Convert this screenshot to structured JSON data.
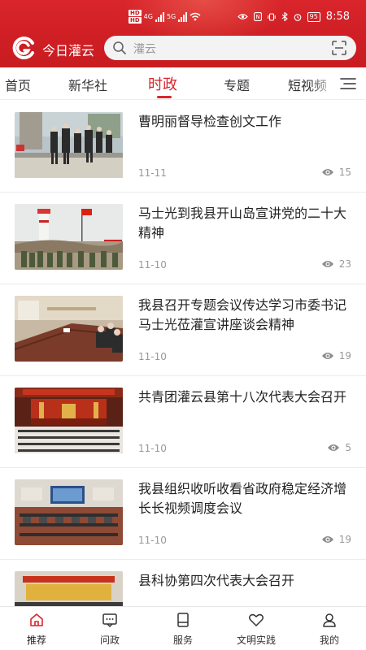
{
  "status_bar": {
    "sim1": "HD",
    "sim2": "HD",
    "network": "4G",
    "network2": "5G",
    "battery": "95",
    "time": "8:58"
  },
  "header": {
    "app_name": "今日灌云",
    "search_placeholder": "灌云"
  },
  "tabs": [
    {
      "label": "首页"
    },
    {
      "label": "新华社"
    },
    {
      "label": "时政"
    },
    {
      "label": "专题"
    },
    {
      "label": "短视频"
    }
  ],
  "active_tab": "时政",
  "feed": [
    {
      "title": "曹明丽督导检查创文工作",
      "date": "11-11",
      "views": "15",
      "thumb": "inspection-photo"
    },
    {
      "title": "马士光到我县开山岛宣讲党的二十大精神",
      "date": "11-10",
      "views": "23",
      "thumb": "island-lighthouse-photo"
    },
    {
      "title": "我县召开专题会议传达学习市委书记马士光莅灌宣讲座谈会精神",
      "date": "11-10",
      "views": "19",
      "thumb": "meeting-room-photo"
    },
    {
      "title": "共青团灌云县第十八次代表大会召开",
      "date": "11-10",
      "views": "5",
      "thumb": "congress-hall-photo"
    },
    {
      "title": "我县组织收听收看省政府稳定经济增长长视频调度会议",
      "date": "11-10",
      "views": "19",
      "thumb": "video-conference-photo"
    },
    {
      "title": "县科协第四次代表大会召开",
      "date": "",
      "views": "",
      "thumb": "assembly-photo"
    }
  ],
  "bottom_nav": [
    {
      "label": "推荐",
      "icon": "home-icon"
    },
    {
      "label": "问政",
      "icon": "message-icon"
    },
    {
      "label": "服务",
      "icon": "service-icon"
    },
    {
      "label": "文明实践",
      "icon": "heart-icon"
    },
    {
      "label": "我的",
      "icon": "user-icon"
    }
  ],
  "colors": {
    "brand_red": "#d9252b",
    "text_muted": "#999999"
  }
}
